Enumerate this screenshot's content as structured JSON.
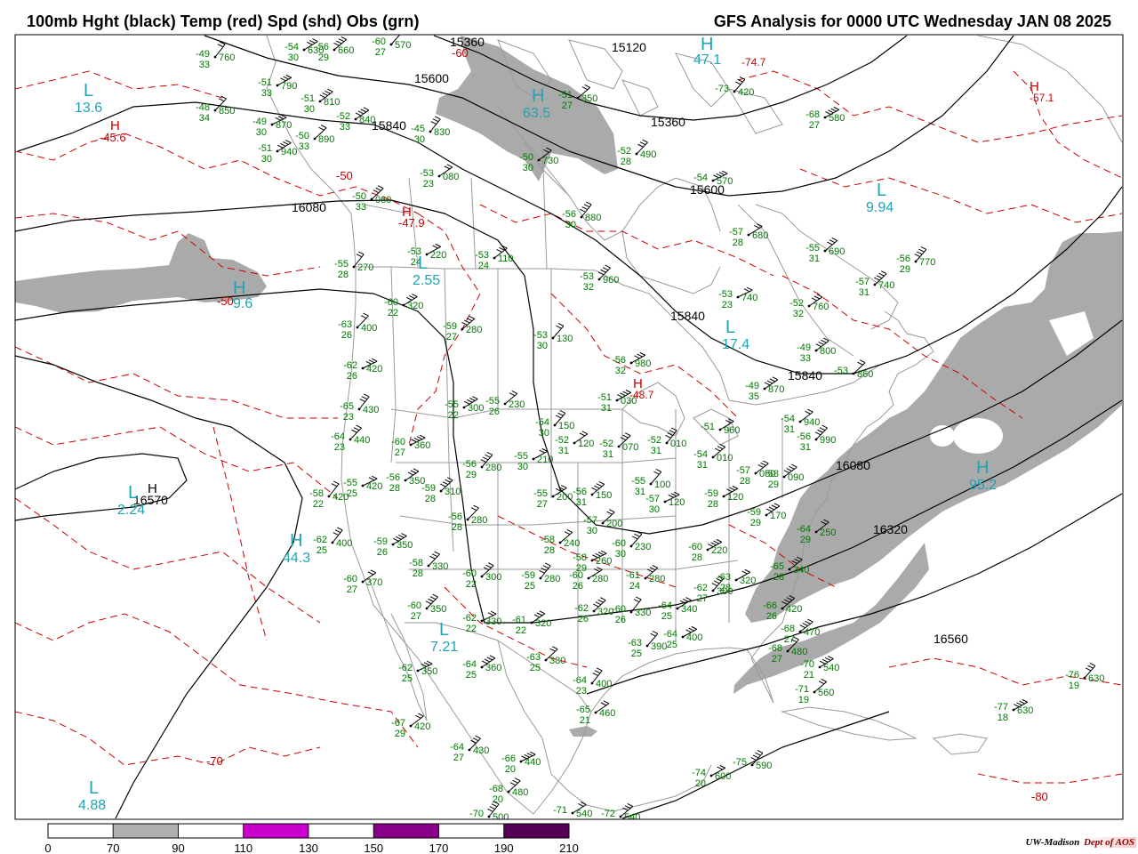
{
  "header": {
    "title_left": "100mb Hght (black) Temp (red) Spd (shd) Obs (grn)",
    "title_right": "GFS Analysis for 0000 UTC Wednesday  JAN 08 2025"
  },
  "footer": {
    "credit_org": "UW-Madison",
    "credit_dept": "Dept of AOS"
  },
  "colorbar": {
    "ticks": [
      "0",
      "70",
      "90",
      "110",
      "130",
      "150",
      "170",
      "190",
      "210"
    ],
    "fills": [
      "#ffffff",
      "#b0b0b0",
      "#ffffff",
      "#cc00cc",
      "#ffffff",
      "#880088",
      "#ffffff",
      "#550055"
    ]
  },
  "colors": {
    "height": "#000000",
    "temperature": "#cc0000",
    "speed_shade": "#a8a8a8",
    "obs": "#007700",
    "centers": "#1fa3b5",
    "borders": "#999999"
  },
  "height_labels": [
    "15360",
    "15120",
    "15600",
    "15840",
    "15360",
    "15600",
    "16080",
    "15840",
    "15840",
    "16080",
    "16320",
    "16560",
    "16570"
  ],
  "temp_labels": [
    "-60",
    "-45.6",
    "-50",
    "-47.9",
    "-50",
    "-70",
    "-80"
  ],
  "centers": [
    {
      "letter": "L",
      "value": "13.6"
    },
    {
      "letter": "H",
      "value": "47.1"
    },
    {
      "letter": "H",
      "value": "63.5"
    },
    {
      "letter": "L",
      "value": "9.94"
    },
    {
      "letter": "L",
      "value": "2.55"
    },
    {
      "letter": "H",
      "value": "9.6"
    },
    {
      "letter": "L",
      "value": "17.4"
    },
    {
      "letter": "H",
      "value": "95.2"
    },
    {
      "letter": "L",
      "value": "2.24"
    },
    {
      "letter": "H",
      "value": "44.3"
    },
    {
      "letter": "L",
      "value": "7.21"
    },
    {
      "letter": "L",
      "value": "4.88"
    }
  ],
  "observations": [
    {
      "t": "-49",
      "h": "760",
      "d": "33"
    },
    {
      "t": "-54",
      "h": "630",
      "d": "30"
    },
    {
      "t": "-56",
      "h": "660",
      "d": "29"
    },
    {
      "t": "-60",
      "h": "570",
      "d": "27"
    },
    {
      "t": "-51",
      "h": "790",
      "d": "33"
    },
    {
      "t": "-51",
      "h": "810",
      "d": "30"
    },
    {
      "t": "-48",
      "h": "850",
      "d": "34"
    },
    {
      "t": "-49",
      "h": "870",
      "d": "30"
    },
    {
      "t": "-52",
      "h": "840",
      "d": "33"
    },
    {
      "t": "-50",
      "h": "890",
      "d": "33"
    },
    {
      "t": "-45",
      "h": "830",
      "d": "30"
    },
    {
      "t": "-51",
      "h": "940",
      "d": "30"
    },
    {
      "t": "-51",
      "h": "350",
      "d": "27"
    },
    {
      "t": "-73",
      "h": "420",
      "d": ""
    },
    {
      "t": "-68",
      "h": "580",
      "d": "27"
    },
    {
      "t": "-50",
      "h": "730",
      "d": "30"
    },
    {
      "t": "-52",
      "h": "490",
      "d": "28"
    },
    {
      "t": "-54",
      "h": "570",
      "d": ""
    },
    {
      "t": "-53",
      "h": "080",
      "d": "23"
    },
    {
      "t": "-50",
      "h": "060",
      "d": "33"
    },
    {
      "t": "-56",
      "h": "880",
      "d": "30"
    },
    {
      "t": "-57",
      "h": "680",
      "d": "28"
    },
    {
      "t": "-55",
      "h": "690",
      "d": "31"
    },
    {
      "t": "-56",
      "h": "770",
      "d": "29"
    },
    {
      "t": "-53",
      "h": "220",
      "d": "24"
    },
    {
      "t": "-53",
      "h": "110",
      "d": "24"
    },
    {
      "t": "-53",
      "h": "960",
      "d": "32"
    },
    {
      "t": "-53",
      "h": "740",
      "d": "23"
    },
    {
      "t": "-52",
      "h": "760",
      "d": "32"
    },
    {
      "t": "-57",
      "h": "740",
      "d": "31"
    },
    {
      "t": "-55",
      "h": "270",
      "d": "28"
    },
    {
      "t": "-60",
      "h": "320",
      "d": "22"
    },
    {
      "t": "-59",
      "h": "280",
      "d": "27"
    },
    {
      "t": "-53",
      "h": "130",
      "d": "30"
    },
    {
      "t": "-56",
      "h": "980",
      "d": "32"
    },
    {
      "t": "-49",
      "h": "800",
      "d": "33"
    },
    {
      "t": "-63",
      "h": "400",
      "d": "26"
    },
    {
      "t": "-62",
      "h": "420",
      "d": "26"
    },
    {
      "t": "-49",
      "h": "870",
      "d": "35"
    },
    {
      "t": "-53",
      "h": "860",
      "d": ""
    },
    {
      "t": "-65",
      "h": "430",
      "d": "23"
    },
    {
      "t": "-55",
      "h": "300",
      "d": "22"
    },
    {
      "t": "-55",
      "h": "230",
      "d": "26"
    },
    {
      "t": "-54",
      "h": "150",
      "d": "30"
    },
    {
      "t": "-51",
      "h": "030",
      "d": "31"
    },
    {
      "t": "-54",
      "h": "940",
      "d": "31"
    },
    {
      "t": "-64",
      "h": "440",
      "d": "23"
    },
    {
      "t": "-60",
      "h": "360",
      "d": "27"
    },
    {
      "t": "-52",
      "h": "120",
      "d": "31"
    },
    {
      "t": "-52",
      "h": "070",
      "d": "31"
    },
    {
      "t": "-52",
      "h": "010",
      "d": "31"
    },
    {
      "t": "-51",
      "h": "960",
      "d": ""
    },
    {
      "t": "-54",
      "h": "010",
      "d": "31"
    },
    {
      "t": "-56",
      "h": "280",
      "d": "29"
    },
    {
      "t": "-55",
      "h": "210",
      "d": "30"
    },
    {
      "t": "-57",
      "h": "050",
      "d": "28"
    },
    {
      "t": "-56",
      "h": "990",
      "d": "31"
    },
    {
      "t": "-55",
      "h": "420",
      "d": "25"
    },
    {
      "t": "-56",
      "h": "350",
      "d": "28"
    },
    {
      "t": "-59",
      "h": "310",
      "d": "28"
    },
    {
      "t": "-58",
      "h": "420",
      "d": "22"
    },
    {
      "t": "-55",
      "h": "200",
      "d": "27"
    },
    {
      "t": "-56",
      "h": "150",
      "d": "31"
    },
    {
      "t": "-55",
      "h": "100",
      "d": "31"
    },
    {
      "t": "-59",
      "h": "120",
      "d": "28"
    },
    {
      "t": "-58",
      "h": "090",
      "d": "29"
    },
    {
      "t": "-56",
      "h": "280",
      "d": "28"
    },
    {
      "t": "-57",
      "h": "120",
      "d": "30"
    },
    {
      "t": "-59",
      "h": "170",
      "d": "29"
    },
    {
      "t": "-57",
      "h": "200",
      "d": "30"
    },
    {
      "t": "-62",
      "h": "400",
      "d": "25"
    },
    {
      "t": "-59",
      "h": "350",
      "d": "26"
    },
    {
      "t": "-58",
      "h": "240",
      "d": "28"
    },
    {
      "t": "-60",
      "h": "230",
      "d": "30"
    },
    {
      "t": "-60",
      "h": "220",
      "d": "28"
    },
    {
      "t": "-64",
      "h": "250",
      "d": "29"
    },
    {
      "t": "-58",
      "h": "330",
      "d": "28"
    },
    {
      "t": "-58",
      "h": "260",
      "d": "29"
    },
    {
      "t": "-60",
      "h": "370",
      "d": "27"
    },
    {
      "t": "-60",
      "h": "300",
      "d": "22"
    },
    {
      "t": "-59",
      "h": "280",
      "d": "25"
    },
    {
      "t": "-60",
      "h": "280",
      "d": "26"
    },
    {
      "t": "-61",
      "h": "280",
      "d": "24"
    },
    {
      "t": "-62",
      "h": "300",
      "d": "27"
    },
    {
      "t": "-63",
      "h": "320",
      "d": "28"
    },
    {
      "t": "-65",
      "h": "340",
      "d": "28"
    },
    {
      "t": "-60",
      "h": "350",
      "d": "27"
    },
    {
      "t": "-62",
      "h": "330",
      "d": "22"
    },
    {
      "t": "-61",
      "h": "320",
      "d": "22"
    },
    {
      "t": "-62",
      "h": "320",
      "d": "26"
    },
    {
      "t": "-60",
      "h": "330",
      "d": "26"
    },
    {
      "t": "-64",
      "h": "340",
      "d": "25"
    },
    {
      "t": "-66",
      "h": "420",
      "d": "26"
    },
    {
      "t": "-63",
      "h": "390",
      "d": "25"
    },
    {
      "t": "-64",
      "h": "400",
      "d": "25"
    },
    {
      "t": "-68",
      "h": "470",
      "d": "27"
    },
    {
      "t": "-68",
      "h": "480",
      "d": "27"
    },
    {
      "t": "-62",
      "h": "350",
      "d": "25"
    },
    {
      "t": "-64",
      "h": "360",
      "d": "25"
    },
    {
      "t": "-63",
      "h": "380",
      "d": "25"
    },
    {
      "t": "-64",
      "h": "400",
      "d": "23"
    },
    {
      "t": "-70",
      "h": "540",
      "d": "21"
    },
    {
      "t": "-71",
      "h": "560",
      "d": "19"
    },
    {
      "t": "-76",
      "h": "630",
      "d": "19"
    },
    {
      "t": "-77",
      "h": "630",
      "d": "18"
    },
    {
      "t": "-67",
      "h": "420",
      "d": "29"
    },
    {
      "t": "-64",
      "h": "430",
      "d": "27"
    },
    {
      "t": "-66",
      "h": "440",
      "d": "20"
    },
    {
      "t": "-65",
      "h": "460",
      "d": "21"
    },
    {
      "t": "-68",
      "h": "480",
      "d": "20"
    },
    {
      "t": "-70",
      "h": "500",
      "d": ""
    },
    {
      "t": "-71",
      "h": "540",
      "d": ""
    },
    {
      "t": "-72",
      "h": "540",
      "d": ""
    },
    {
      "t": "-75",
      "h": "590",
      "d": ""
    },
    {
      "t": "-74",
      "h": "600",
      "d": "20"
    }
  ]
}
